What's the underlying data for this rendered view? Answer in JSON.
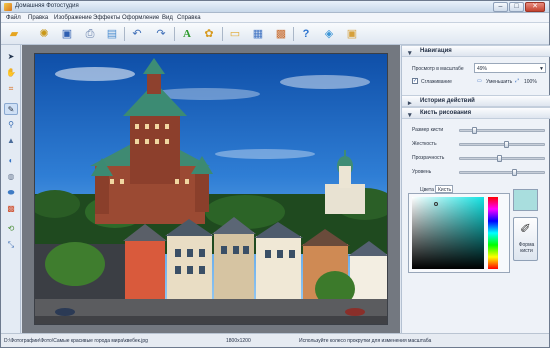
{
  "window": {
    "title": "Домашняя Фотостудия",
    "buttons": {
      "minimize": "–",
      "maximize": "□",
      "close": "✕"
    }
  },
  "menu": {
    "items": [
      "Файл",
      "Правка",
      "Изображение",
      "Эффекты",
      "Оформление",
      "Вид",
      "Справка"
    ]
  },
  "toolbar": {
    "buttons": [
      "open-folder-icon",
      "gear-icon",
      "save-icon",
      "print-icon",
      "preview-icon",
      "undo-icon",
      "redo-icon",
      "text-icon",
      "palette-icon",
      "frame-icon",
      "calendar-icon",
      "collage-icon",
      "help-icon",
      "layers-icon",
      "box-icon"
    ]
  },
  "lefttools": {
    "tools": [
      "cursor-icon",
      "hand-icon",
      "crop-icon",
      "brush-icon",
      "dropper-icon",
      "blur-icon",
      "contrast-icon",
      "lens-icon",
      "clone-icon",
      "gradient-icon",
      "rotate-icon",
      "resize-icon"
    ]
  },
  "panel": {
    "navigation": {
      "title": "Навигация",
      "zoom_label": "Просмотр в масштабе",
      "zoom_value": "49%",
      "smoothing_label": "Сглаживание",
      "smoothing_checked": true,
      "fit_label": "Уменьшить",
      "full_label": "100%"
    },
    "history": {
      "title": "История действий"
    },
    "brush": {
      "title": "Кисть рисования",
      "size_label": "Размер кисти",
      "hardness_label": "Жесткость",
      "opacity_label": "Прозрачность",
      "level_label": "Уровень",
      "size_level": 0.16,
      "hardness_level": 0.55,
      "opacity_level": 0.47,
      "flow_level": 0.65,
      "colors_label": "Цвета",
      "tab_label": "Кисть",
      "brush_shape_label": "Форма кисти",
      "swatch_color": "#a9dede"
    }
  },
  "status": {
    "path": "D:\\Фотографии\\Фото\\Самые красивые города мира\\квебек.jpg",
    "dimensions": "1800x1200",
    "hint": "Используйте колесо прокрутки для изменения масштаба"
  }
}
